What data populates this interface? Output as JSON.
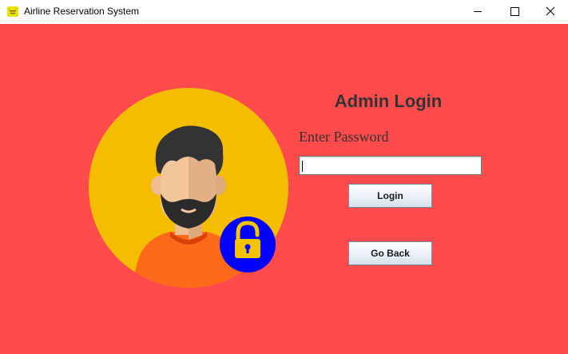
{
  "window": {
    "title": "Airline Reservation System",
    "app_icon": "java-app-icon",
    "controls": [
      "minimize-icon",
      "maximize-icon",
      "close-icon"
    ]
  },
  "login": {
    "heading": "Admin Login",
    "password_label": "Enter Password",
    "password_value": "",
    "login_button": "Login",
    "back_button": "Go Back"
  },
  "illustration": {
    "icon": "admin-avatar-with-lock"
  },
  "colors": {
    "background": "#ff4b4b",
    "avatar_circle": "#f5bd00",
    "lock_badge": "#0000ff",
    "lock": "#f5c400",
    "shirt": "#ff6a1a"
  }
}
